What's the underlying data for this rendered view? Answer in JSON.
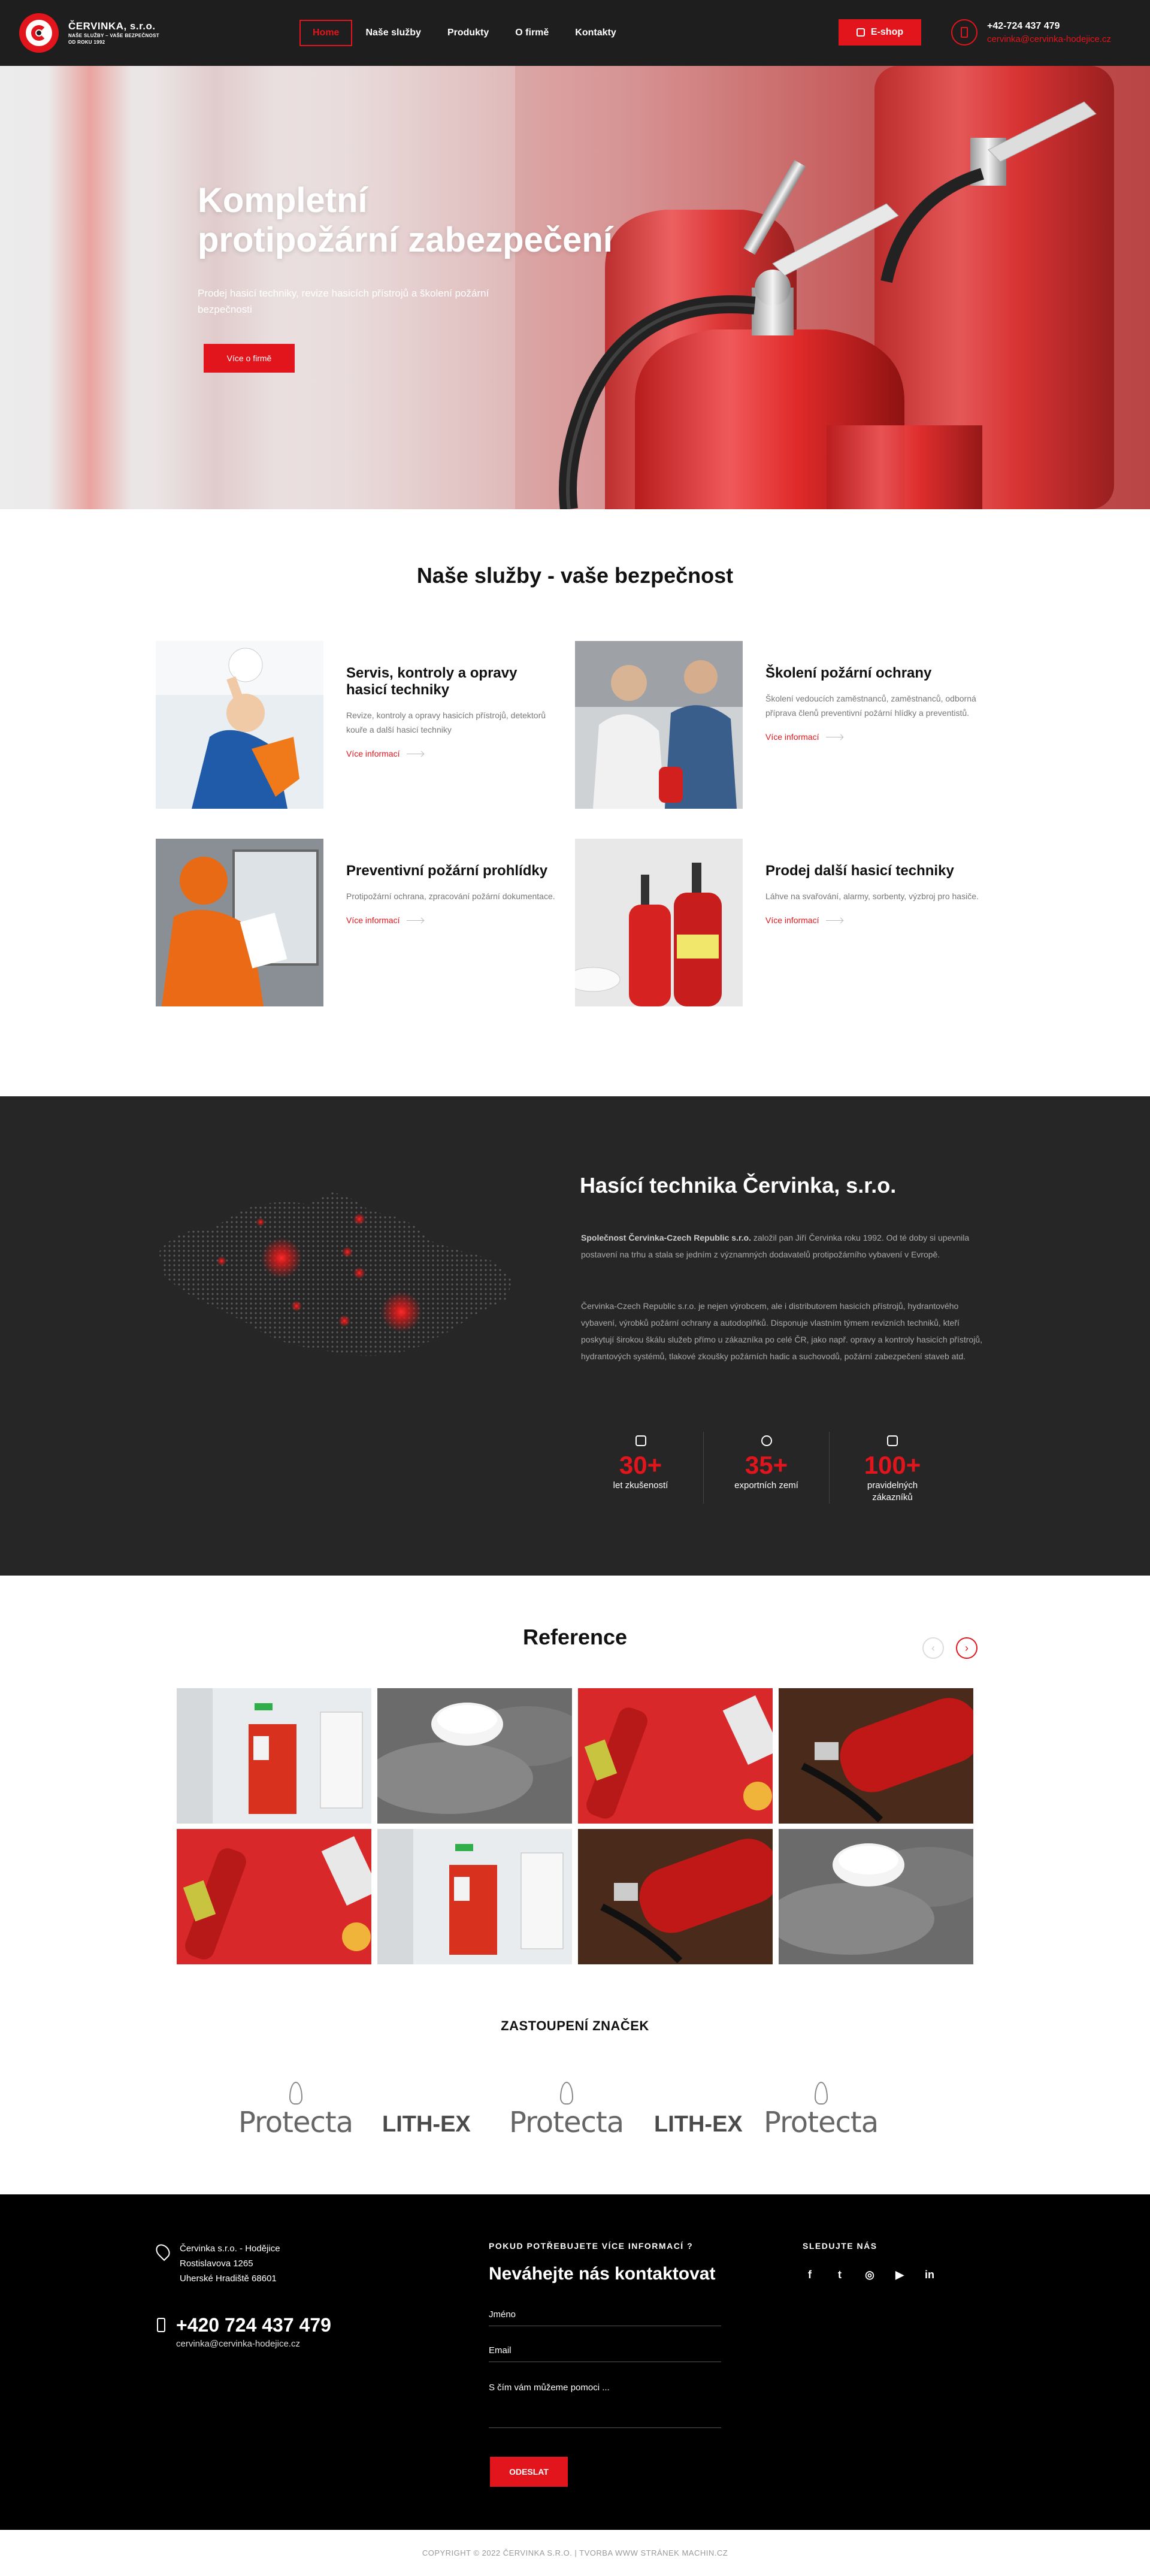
{
  "header": {
    "logo_name": "ČERVINKA, s.r.o.",
    "logo_tagline1": "NAŠE SLUŽBY – VAŠE BEZPEČNOST",
    "logo_tagline2": "OD ROKU 1992",
    "nav": [
      "Home",
      "Naše služby",
      "Produkty",
      "O firmě",
      "Kontakty"
    ],
    "active_nav": "Home",
    "eshop_label": "E-shop",
    "phone": "+42-724 437 479",
    "email": "cervinka@cervinka-hodejice.cz"
  },
  "hero": {
    "title_line1": "Kompletní",
    "title_line2": "protipožární zabezpečení",
    "subtitle": "Prodej hasicí techniky, revize hasicích přístrojů a školení požární bezpečnosti",
    "button": "Více o firmě"
  },
  "services": {
    "title": "Naše služby - vaše bezpečnost",
    "more_label": "Více informací",
    "items": [
      {
        "title": "Servis, kontroly a opravy hasicí techniky",
        "text": "Revize, kontroly a opravy hasicích přístrojů, detektorů kouře a další hasicí techniky"
      },
      {
        "title": "Školení požární ochrany",
        "text": "Školení vedoucích zaměstnanců, zaměstnanců, odborná příprava členů preventivní požární hlídky a preventistů."
      },
      {
        "title": "Preventivní požární prohlídky",
        "text": "Protipožární ochrana, zpracování požární dokumentace."
      },
      {
        "title": "Prodej další hasicí techniky",
        "text": "Láhve na svařování, alarmy, sorbenty, výzbroj pro hasiče."
      }
    ]
  },
  "about": {
    "title": "Hasící technika Červinka, s.r.o.",
    "p1_bold": "Společnost Červinka-Czech Republic s.r.o.",
    "p1_rest": " založil pan Jiří Červinka roku 1992. Od té doby si upevnila postavení na trhu a stala se jedním z významných dodavatelů protipožárního vybavení v Evropě.",
    "p2": "Červinka-Czech Republic s.r.o. je nejen výrobcem, ale i distributorem hasicích přístrojů, hydrantového vybavení, výrobků požární ochrany a autodoplňků. Disponuje vlastním týmem revizních techniků, kteří poskytují širokou škálu služeb přímo u zákazníka po celé ČR, jako např. opravy a kontroly hasicích přístrojů, hydrantových systémů, tlakové zkoušky požárních hadic a suchovodů, požární zabezpečení staveb atd.",
    "stats": [
      {
        "icon": "shield-icon",
        "value": "30+",
        "label": "let zkušeností"
      },
      {
        "icon": "globe-icon",
        "value": "35+",
        "label": "exportních zemí"
      },
      {
        "icon": "crown-icon",
        "value": "100+",
        "label": "pravidelných zákazníků"
      }
    ]
  },
  "reference": {
    "title": "Reference",
    "prev_icon": "chevron-left-icon",
    "next_icon": "chevron-right-icon"
  },
  "brands": {
    "title": "ZASTOUPENÍ ZNAČEK",
    "items": [
      "Protecta",
      "LITH-EX",
      "Protecta",
      "LITH-EX",
      "Protecta"
    ]
  },
  "footer": {
    "address": [
      "Červinka s.r.o. - Hodějice",
      "Rostislavova 1265",
      "Uherské Hradiště 68601"
    ],
    "phone": "+420 724 437 479",
    "email": "cervinka@cervinka-hodejice.cz",
    "contact_subtitle": "POKUD POTŘEBUJETE VÍCE INFORMACÍ ?",
    "contact_title": "Neváhejte nás kontaktovat",
    "field_name": "Jméno",
    "field_email": "Email",
    "field_message": "S čím vám můžeme pomoci ...",
    "send": "ODESLAT",
    "social_title": "SLEDUJTE NÁS",
    "socials": [
      "f",
      "t",
      "◎",
      "▶",
      "in"
    ]
  },
  "copyright": "COPYRIGHT © 2022 ČERVINKA S.R.O. | TVORBA WWW STRÁNEK MACHIN.CZ",
  "colors": {
    "accent": "#e3151c",
    "dark": "#1e1e1e",
    "section_dark": "#262626"
  }
}
